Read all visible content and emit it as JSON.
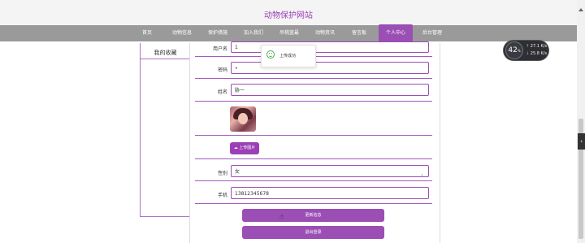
{
  "site": {
    "title": "动物保护网站"
  },
  "nav": {
    "items": [
      {
        "label": "首页"
      },
      {
        "label": "动物信息"
      },
      {
        "label": "保护措施"
      },
      {
        "label": "加入我们"
      },
      {
        "label": "吊桃蓝最"
      },
      {
        "label": "动物资讯"
      },
      {
        "label": "留言板"
      },
      {
        "label": "个人中心"
      },
      {
        "label": "后台管理"
      }
    ],
    "active": "个人中心"
  },
  "sidebar": {
    "items": [
      {
        "label": "我的收藏"
      }
    ]
  },
  "form": {
    "username_label": "用户名",
    "username_value": "1",
    "password_label": "密码",
    "password_value": "•",
    "name_label": "姓名",
    "name_value": "胁一",
    "upload_label": "上传图片",
    "gender_label": "性别",
    "gender_value": "女",
    "phone_label": "手机",
    "phone_value": "13812345678",
    "update_button": "更新信息",
    "logout_button": "退出登录"
  },
  "toast": {
    "message": "上传成功"
  },
  "widget": {
    "percent": "42",
    "percent_unit": "%",
    "upload_speed": "27.1",
    "download_speed": "25.8",
    "speed_unit": "K/s"
  },
  "colors": {
    "accent": "#9b4eb4",
    "nav_bg": "#9a9a9a",
    "title": "#9b3fb6"
  }
}
